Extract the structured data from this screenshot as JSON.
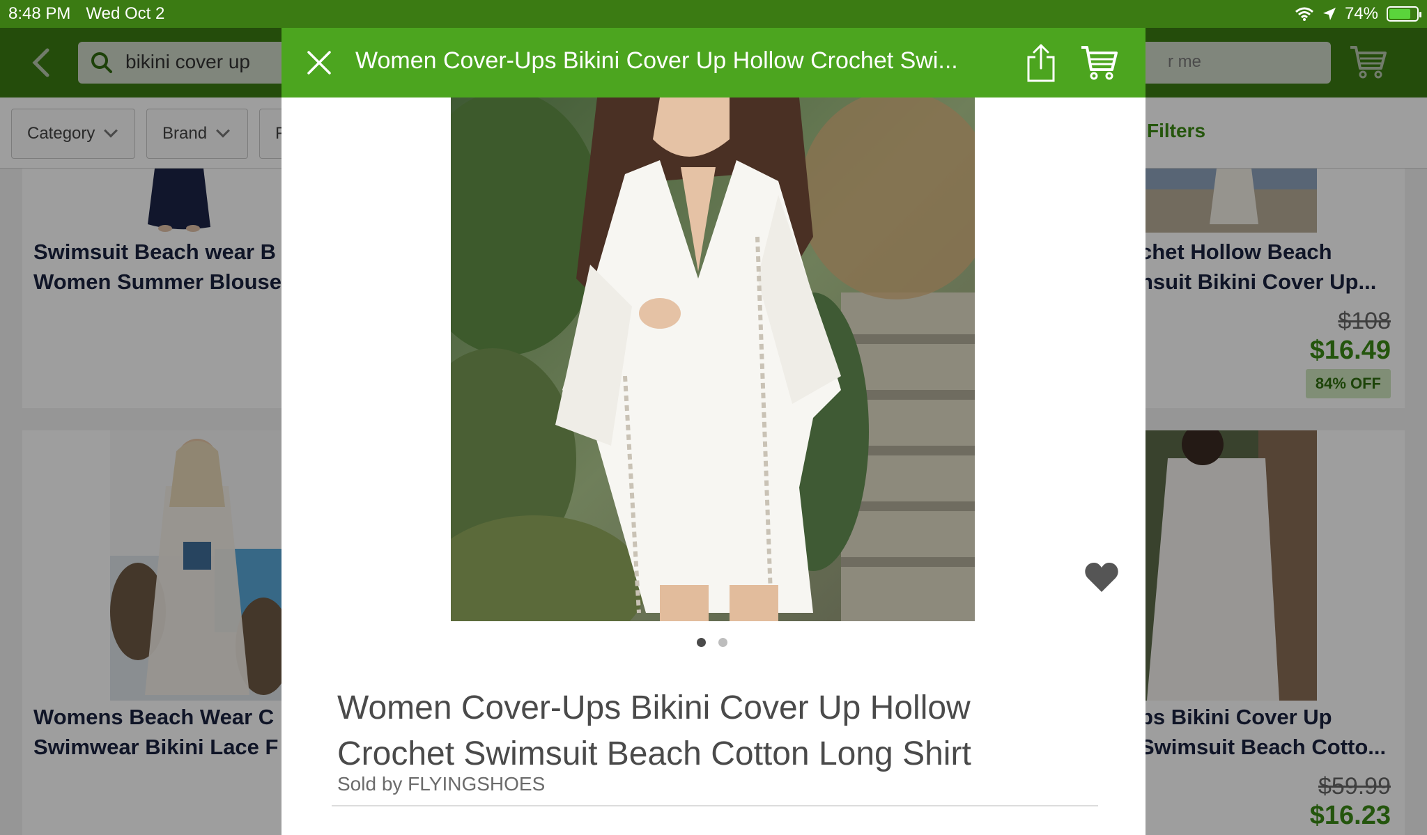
{
  "status_bar": {
    "time": "8:48 PM",
    "date": "Wed Oct 2",
    "battery": "74%"
  },
  "header": {
    "search_query": "bikini cover up",
    "search_placeholder_fragment": "r me"
  },
  "filters": {
    "chips": [
      "Category",
      "Brand",
      "F"
    ],
    "filters_label": "Filters"
  },
  "grid": {
    "cards": [
      {
        "title_line1": "Swimsuit Beach wear B",
        "title_line2": "Women Summer Blouse"
      },
      {
        "title_line1": "chet Hollow Beach",
        "title_line2": "nsuit Bikini Cover Up...",
        "old_price": "$108",
        "price": "$16.49",
        "discount": "84% OFF"
      },
      {
        "title_line1": "Womens Beach Wear C",
        "title_line2": "Swimwear Bikini Lace F"
      },
      {
        "title_line1": "ps Bikini Cover Up",
        "title_line2": "Swimsuit Beach Cotto...",
        "old_price": "$59.99",
        "price": "$16.23"
      }
    ]
  },
  "modal": {
    "header_title": "Women Cover-Ups Bikini Cover Up Hollow Crochet Swi...",
    "product_title": "Women Cover-Ups Bikini Cover Up Hollow Crochet Swimsuit Beach Cotton Long Shirt",
    "seller": "Sold by FLYINGSHOES",
    "image_count": 2,
    "active_image": 1
  },
  "colors": {
    "header_green": "#3b7b13",
    "modal_header_green": "#4ca51f",
    "price_green": "#3a8a15"
  },
  "icons": [
    "back-chevron-icon",
    "search-icon",
    "cart-icon",
    "close-icon",
    "share-icon",
    "heart-icon",
    "wifi-icon",
    "location-arrow-icon",
    "battery-icon"
  ]
}
